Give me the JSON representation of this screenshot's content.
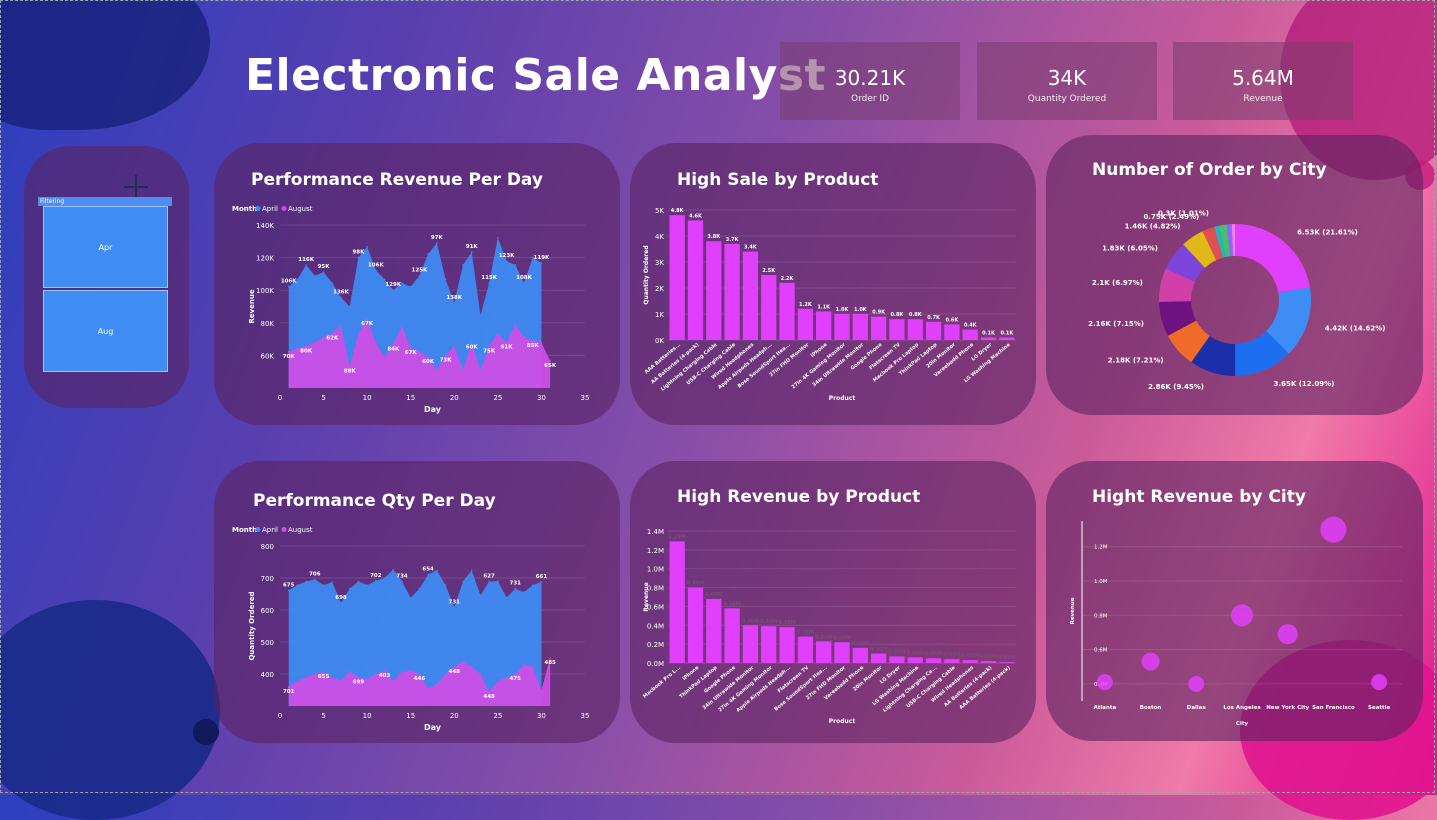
{
  "title": "Electronic Sale Analyst",
  "kpis": [
    {
      "value": "30.21K",
      "label": "Order ID"
    },
    {
      "value": "34K",
      "label": "Quantity Ordered"
    },
    {
      "value": "5.64M",
      "label": "Revenue"
    }
  ],
  "filter": {
    "header": "Filtering",
    "options": [
      "Apr",
      "Aug"
    ]
  },
  "cards": {
    "rev_day": "Performance Revenue Per Day",
    "qty_day": "Performance Qty Per Day",
    "sale_product": "High Sale by Product",
    "rev_product": "High Revenue by Product",
    "order_city": "Number of Order by City",
    "rev_city": "Hight Revenue by City"
  },
  "chart_data": [
    {
      "type": "area",
      "title": "Performance Revenue Per Day",
      "legend_title": "Month",
      "xlabel": "Day",
      "ylabel": "Revenue",
      "xlim": [
        0,
        35
      ],
      "ylim": [
        50000,
        140000
      ],
      "xticks": [
        "0",
        "5",
        "10",
        "15",
        "20",
        "25",
        "30",
        "35"
      ],
      "yticks": [
        "60K",
        "80K",
        "100K",
        "120K",
        "140K"
      ],
      "legend_position": "top-left",
      "series": [
        {
          "name": "April",
          "color": "#3d8df5",
          "x": [
            1,
            2,
            3,
            4,
            5,
            6,
            7,
            8,
            9,
            10,
            11,
            12,
            13,
            14,
            15,
            16,
            17,
            18,
            19,
            20,
            21,
            22,
            23,
            24,
            25,
            26,
            27,
            28,
            29,
            30
          ],
          "values": [
            106000,
            110000,
            118000,
            112000,
            114000,
            108000,
            100000,
            95000,
            122000,
            128000,
            115000,
            110000,
            104000,
            108000,
            106000,
            112000,
            124000,
            130000,
            110000,
            97000,
            118000,
            125000,
            90000,
            108000,
            133000,
            120000,
            118000,
            108000,
            122000,
            119000
          ]
        },
        {
          "name": "August",
          "color": "#cc4fe6",
          "x": [
            1,
            2,
            3,
            4,
            5,
            6,
            7,
            8,
            9,
            10,
            11,
            12,
            13,
            14,
            15,
            16,
            17,
            18,
            19,
            20,
            21,
            22,
            23,
            24,
            25,
            26,
            27,
            28,
            29,
            30,
            31
          ],
          "values": [
            70000,
            72000,
            73000,
            75000,
            78000,
            80000,
            84000,
            62000,
            80000,
            88000,
            75000,
            67000,
            74000,
            84000,
            72000,
            70000,
            67000,
            60000,
            68000,
            73000,
            60000,
            75000,
            60000,
            73000,
            80000,
            75000,
            85000,
            78000,
            76000,
            75000,
            65000
          ]
        }
      ],
      "labels": [
        "106K",
        "116K",
        "95K",
        "136K",
        "98K",
        "106K",
        "129K",
        "125K",
        "97K",
        "138K",
        "91K",
        "115K",
        "123K",
        "108K",
        "119K",
        "70K",
        "80K",
        "62K",
        "88K",
        "67K",
        "84K",
        "67K",
        "60K",
        "73K",
        "60K",
        "75K",
        "61K",
        "85K",
        "65K"
      ]
    },
    {
      "type": "area",
      "title": "Performance Qty Per Day",
      "legend_title": "Month",
      "xlabel": "Day",
      "ylabel": "Quantity Ordered",
      "xlim": [
        0,
        35
      ],
      "ylim": [
        350,
        800
      ],
      "xticks": [
        "0",
        "5",
        "10",
        "15",
        "20",
        "25",
        "30",
        "35"
      ],
      "yticks": [
        "400",
        "500",
        "600",
        "700",
        "800"
      ],
      "legend_position": "top-left",
      "series": [
        {
          "name": "April",
          "color": "#3d8df5",
          "x": [
            1,
            2,
            3,
            4,
            5,
            6,
            7,
            8,
            9,
            10,
            11,
            12,
            13,
            14,
            15,
            16,
            17,
            18,
            19,
            20,
            21,
            22,
            23,
            24,
            25,
            26,
            27,
            28,
            29,
            30
          ],
          "values": [
            675,
            690,
            700,
            706,
            690,
            698,
            640,
            680,
            700,
            690,
            702,
            710,
            734,
            700,
            654,
            680,
            720,
            731,
            690,
            627,
            700,
            731,
            661,
            700,
            701,
            655,
            680,
            670,
            690,
            699
          ]
        },
        {
          "name": "August",
          "color": "#cc4fe6",
          "x": [
            1,
            2,
            3,
            4,
            5,
            6,
            7,
            8,
            9,
            10,
            11,
            12,
            13,
            14,
            15,
            16,
            17,
            18,
            19,
            20,
            21,
            22,
            23,
            24,
            25,
            26,
            27,
            28,
            29,
            30,
            31
          ],
          "values": [
            403,
            420,
            430,
            440,
            446,
            430,
            420,
            448,
            430,
            425,
            440,
            448,
            420,
            445,
            450,
            440,
            400,
            410,
            440,
            460,
            475,
            460,
            440,
            390,
            420,
            430,
            440,
            465,
            460,
            395,
            485
          ]
        }
      ],
      "labels": [
        "675",
        "706",
        "698",
        "702",
        "734",
        "654",
        "731",
        "627",
        "731",
        "661",
        "701",
        "655",
        "699",
        "403",
        "446",
        "448",
        "448",
        "475",
        "485"
      ]
    },
    {
      "type": "bar",
      "title": "High Sale by Product",
      "xlabel": "Product",
      "ylabel": "Quantity Ordered",
      "ylim": [
        0,
        5000
      ],
      "yticks": [
        "0K",
        "1K",
        "2K",
        "3K",
        "4K",
        "5K"
      ],
      "color": "#e040fb",
      "categories": [
        "AAA Batteries...",
        "AA Batteries (4-pack)",
        "Lightning Charging Cable",
        "USB-C Charging Cable",
        "Wired Headphones",
        "Apple Airpods Headph...",
        "Bose SoundSport Hea...",
        "27in FHD Monitor",
        "iPhone",
        "27in 4K Gaming Monitor",
        "34in Ultrawide Monitor",
        "Google Phone",
        "Flatscreen TV",
        "Macbook Pro Laptop",
        "ThinkPad Laptop",
        "20in Monitor",
        "Vareebadd Phone",
        "LG Dryer",
        "LG Washing Machine"
      ],
      "values": [
        4800,
        4600,
        3800,
        3700,
        3400,
        2500,
        2200,
        1200,
        1100,
        1000,
        1000,
        900,
        800,
        800,
        700,
        600,
        400,
        100,
        100
      ],
      "labels": [
        "4.8K",
        "4.6K",
        "3.8K",
        "3.7K",
        "3.4K",
        "2.5K",
        "2.2K",
        "1.2K",
        "1.1K",
        "1.0K",
        "1.0K",
        "0.9K",
        "0.8K",
        "0.8K",
        "0.7K",
        "0.6K",
        "0.4K",
        "0.1K",
        "0.1K"
      ]
    },
    {
      "type": "bar",
      "title": "High Revenue by Product",
      "xlabel": "Product",
      "ylabel": "Revenue",
      "ylim": [
        0,
        1400000
      ],
      "yticks": [
        "0.0M",
        "0.2M",
        "0.4M",
        "0.6M",
        "0.8M",
        "1.0M",
        "1.2M",
        "1.4M"
      ],
      "color": "#e040fb",
      "categories": [
        "Macbook Pro L...",
        "iPhone",
        "ThinkPad Laptop",
        "Google Phone",
        "34in Ultrawide Monitor",
        "27in 4K Gaming Monitor",
        "Apple Airpods Headph...",
        "Flatscreen TV",
        "Bose SoundSport Hea...",
        "27in FHD Monitor",
        "Vareebadd Phone",
        "20in Monitor",
        "LG Dryer",
        "LG Washing Machine",
        "Lightning Charging Ca...",
        "USB-C Charging Cable",
        "Wired Headphones",
        "AA Batteries (4-pack)",
        "AAA Batteries (4-pack)"
      ],
      "values": [
        1290000,
        800000,
        680000,
        580000,
        400000,
        390000,
        380000,
        280000,
        230000,
        220000,
        160000,
        100000,
        70000,
        60000,
        50000,
        40000,
        30000,
        20000,
        10000
      ],
      "labels": [
        "1.29M",
        "0.80M",
        "0.68M",
        "0.58M",
        "0.40M",
        "0.39M",
        "0.38M",
        "0.28M",
        "0.23M",
        "0.22M",
        "0.16M",
        "0.10M",
        "0.07M",
        "0.06M",
        "0.05M",
        "0.04M",
        "0.03M",
        "0.02M",
        "0.01M"
      ]
    },
    {
      "type": "pie",
      "title": "Number of Order by City",
      "donut": true,
      "values": [
        6530,
        4420,
        3650,
        2860,
        2180,
        2160,
        2100,
        1830,
        1440,
        750,
        300,
        500,
        300,
        200
      ],
      "colors": [
        "#e040fb",
        "#3d8df5",
        "#1e6ff0",
        "#1c2fa8",
        "#f06a2a",
        "#6d1280",
        "#d13fa8",
        "#7a45d8",
        "#e0b81a",
        "#e05050",
        "#2ab0c0",
        "#40c070",
        "#9a60ff",
        "#f080f0"
      ],
      "labels": [
        "6.53K (21.61%)",
        "4.42K (14.62%)",
        "3.65K (12.09%)",
        "2.86K (9.45%)",
        "2.18K (7.21%)",
        "2.16K (7.15%)",
        "2.1K (6.97%)",
        "1.83K (6.05%)",
        "1.46K (4.82%)",
        "0.75K (2.49%)",
        "0.3K (1.01%)"
      ]
    },
    {
      "type": "scatter",
      "title": "Hight Revenue by City",
      "xlabel": "City",
      "ylabel": "Revenue",
      "ylim": [
        0.3,
        1.35
      ],
      "yticks": [
        "0.4M",
        "0.6M",
        "0.8M",
        "1.0M",
        "1.2M"
      ],
      "color": "#e040fb",
      "categories": [
        "Atlanta",
        "Boston",
        "Dallas",
        "Los Angeles",
        "New York City",
        "San Francisco",
        "Seattle"
      ],
      "values": [
        0.41,
        0.53,
        0.4,
        0.8,
        0.69,
        1.3,
        0.41
      ],
      "sizes": [
        8,
        9,
        8,
        11,
        10,
        13,
        8
      ]
    }
  ]
}
